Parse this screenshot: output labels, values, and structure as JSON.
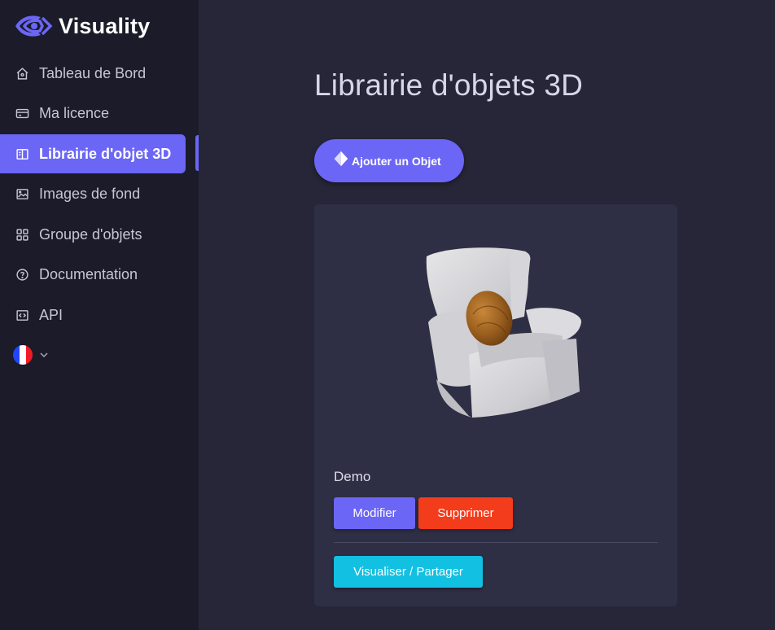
{
  "app": {
    "name": "Visuality"
  },
  "sidebar": {
    "items": [
      {
        "label": "Tableau de Bord",
        "icon": "home-icon",
        "active": false
      },
      {
        "label": "Ma licence",
        "icon": "credit-card-icon",
        "active": false
      },
      {
        "label": "Librairie d'objet 3D",
        "icon": "book-icon",
        "active": true
      },
      {
        "label": "Images de fond",
        "icon": "image-icon",
        "active": false
      },
      {
        "label": "Groupe d'objets",
        "icon": "grid-icon",
        "active": false
      },
      {
        "label": "Documentation",
        "icon": "help-circle-icon",
        "active": false
      },
      {
        "label": "API",
        "icon": "code-icon",
        "active": false
      }
    ],
    "language": {
      "flag": "france-flag-icon",
      "colors": [
        "#1f45ff",
        "#ffffff",
        "#ee1c25"
      ]
    }
  },
  "main": {
    "title": "Librairie d'objets 3D",
    "add_button": "Ajouter un Objet",
    "objects": [
      {
        "name": "Demo",
        "image": "armchair-3d-model",
        "actions": {
          "edit": "Modifier",
          "delete": "Supprimer",
          "view": "Visualiser / Partager"
        }
      }
    ]
  },
  "colors": {
    "primary": "#6b66f5",
    "danger": "#f33c1b",
    "info": "#12c0e2",
    "sidebar_bg": "#1b1b29",
    "main_bg": "#262638",
    "card_bg": "#2e2e45"
  }
}
